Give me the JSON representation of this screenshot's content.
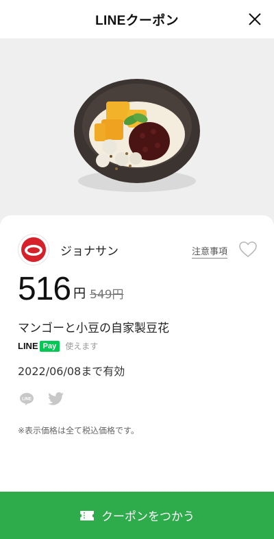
{
  "header": {
    "title": "LINEクーポン",
    "close_icon": "close-icon"
  },
  "brand": {
    "name": "ジョナサン",
    "logo_icon": "brand-logo-icon"
  },
  "notes_link": "注意事項",
  "favorite_icon": "heart-icon",
  "price": {
    "current": "516",
    "unit": "円",
    "original": "549円"
  },
  "product_name": "マンゴーと小豆の自家製豆花",
  "payment": {
    "line": "LINE",
    "pay": "Pay",
    "note": "使えます"
  },
  "validity": "2022/06/08まで有効",
  "share": {
    "line_icon": "line-share-icon",
    "twitter_icon": "twitter-icon"
  },
  "tax_note": "※表示価格は全て税込価格です。",
  "cta": {
    "label": "クーポンをつかう",
    "icon": "ticket-icon"
  },
  "colors": {
    "cta": "#2eac4c",
    "line_green": "#06c755",
    "hero_bg": "#efefef"
  }
}
